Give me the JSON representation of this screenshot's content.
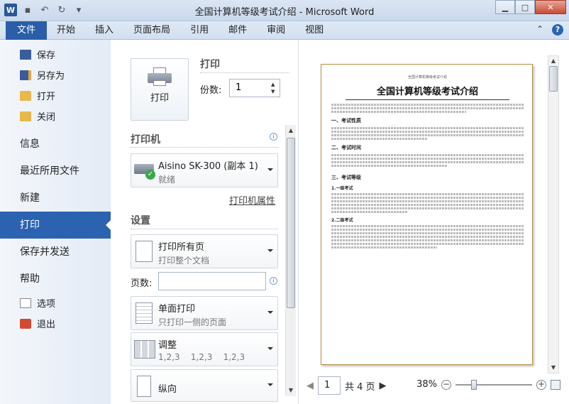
{
  "window": {
    "title": "全国计算机等级考试介绍 - Microsoft Word",
    "app_icon": "W"
  },
  "ribbon": {
    "tabs": [
      "文件",
      "开始",
      "插入",
      "页面布局",
      "引用",
      "邮件",
      "审阅",
      "视图"
    ]
  },
  "backstage": {
    "small_items": [
      "保存",
      "另存为",
      "打开",
      "关闭"
    ],
    "big_items": [
      "信息",
      "最近所用文件",
      "新建",
      "打印",
      "保存并发送",
      "帮助"
    ],
    "bottom_items": [
      "选项",
      "退出"
    ]
  },
  "print": {
    "header": "打印",
    "button_label": "打印",
    "copies_label": "份数:",
    "copies_value": "1",
    "printer_header": "打印机",
    "printer_name": "Aisino SK-300 (副本 1)",
    "printer_status": "就绪",
    "printer_props": "打印机属性",
    "settings_header": "设置",
    "pages_setting_main": "打印所有页",
    "pages_setting_sub": "打印整个文档",
    "pages_label": "页数:",
    "pages_value": "",
    "sides_main": "单面打印",
    "sides_sub": "只打印一侧的页面",
    "collate_main": "调整",
    "collate_sub": "1,2,3    1,2,3    1,2,3",
    "orientation_main": "纵向"
  },
  "preview": {
    "page_header": "全国计算机等级考试介绍",
    "doc_title": "全国计算机等级考试介绍",
    "h1": "一、考试性质",
    "h2": "二、考试时间",
    "h3": "三、考试等级",
    "h3_1": "1.一级考试",
    "h3_2": "2.二级考试"
  },
  "footer": {
    "page_value": "1",
    "total_pages": "共 4 页",
    "zoom": "38%"
  }
}
